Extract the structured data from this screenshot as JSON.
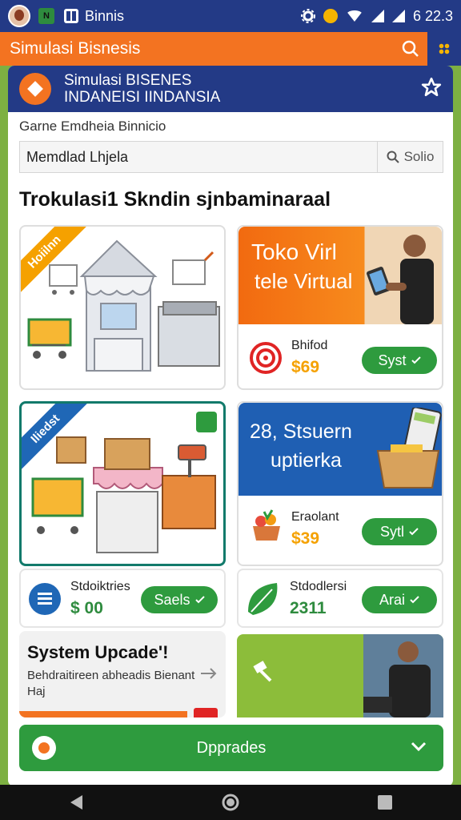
{
  "status_bar": {
    "app_badge": "N",
    "app_name": "Binnis",
    "time": "6 22.3"
  },
  "app_bar": {
    "title": "Simulasi Bisnesis"
  },
  "game": {
    "title_line1": "Simulasi BISENES",
    "title_line2": "INDANEISI IINDANSIA",
    "subtitle": "Garne Emdheia Binnicio",
    "search_value": "Memdlad Lhjela",
    "search_button": "Solio"
  },
  "section_title": "Trokulasi1 Skndin sjnbaminaraal",
  "tiles": {
    "tile1": {
      "ribbon": "Hoiilnn"
    },
    "tile2": {
      "promo_line1": "Toko Virl",
      "promo_line2": "tele Virtual",
      "item_name": "Bhifod",
      "item_price": "$69",
      "button": "Syst"
    },
    "tile3": {
      "ribbon": "Iliedst"
    },
    "tile4": {
      "promo_line1": "28, Stsuern",
      "promo_line2": "uptierka",
      "item_name": "Eraolant",
      "item_price": "$39",
      "button": "Sytl"
    },
    "tile5": {
      "item_name": "Stdoiktries",
      "item_price": "$ 00",
      "button": "Saels"
    },
    "tile6": {
      "item_name": "Stdodlersi",
      "item_price": "2311",
      "button": "Arai"
    },
    "update": {
      "title": "System Upcade'!",
      "description": "Behdraitireen abheadis Bienant Haj"
    }
  },
  "bottom_button": "Dpprades",
  "colors": {
    "navy": "#233a86",
    "orange": "#f37321",
    "green": "#2e9b3e",
    "background_green": "#7db042"
  }
}
